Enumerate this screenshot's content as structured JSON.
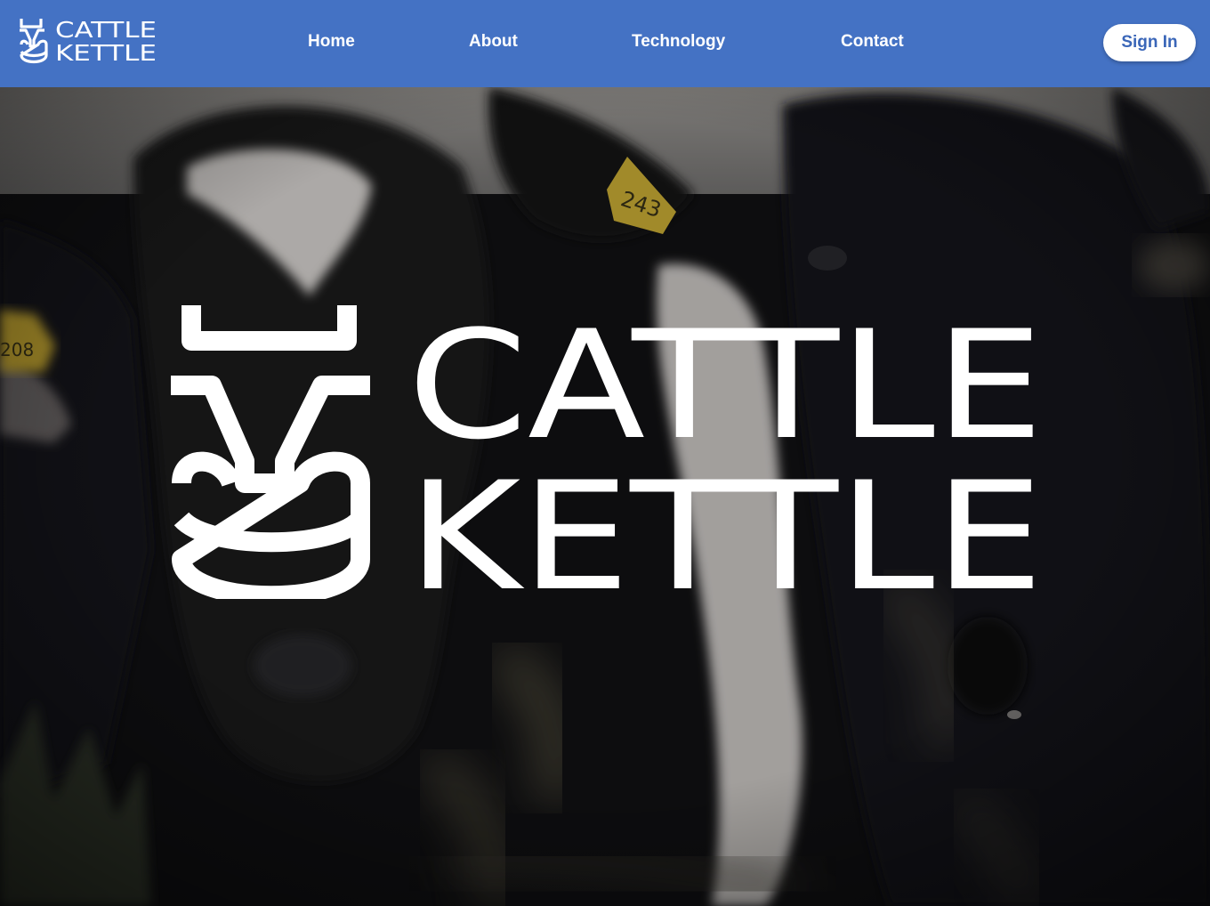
{
  "brand": {
    "name_line1": "CATTLE",
    "name_line2": "KETTLE",
    "color_primary": "#4472c4"
  },
  "nav": {
    "items": [
      {
        "label": "Home"
      },
      {
        "label": "About"
      },
      {
        "label": "Technology"
      },
      {
        "label": "Contact"
      }
    ],
    "sign_in_label": "Sign In"
  },
  "hero": {
    "ear_tags": [
      "243",
      "208"
    ],
    "background_subject": "cow-herd-photo",
    "logo_icon": "bull-kettle-icon"
  }
}
